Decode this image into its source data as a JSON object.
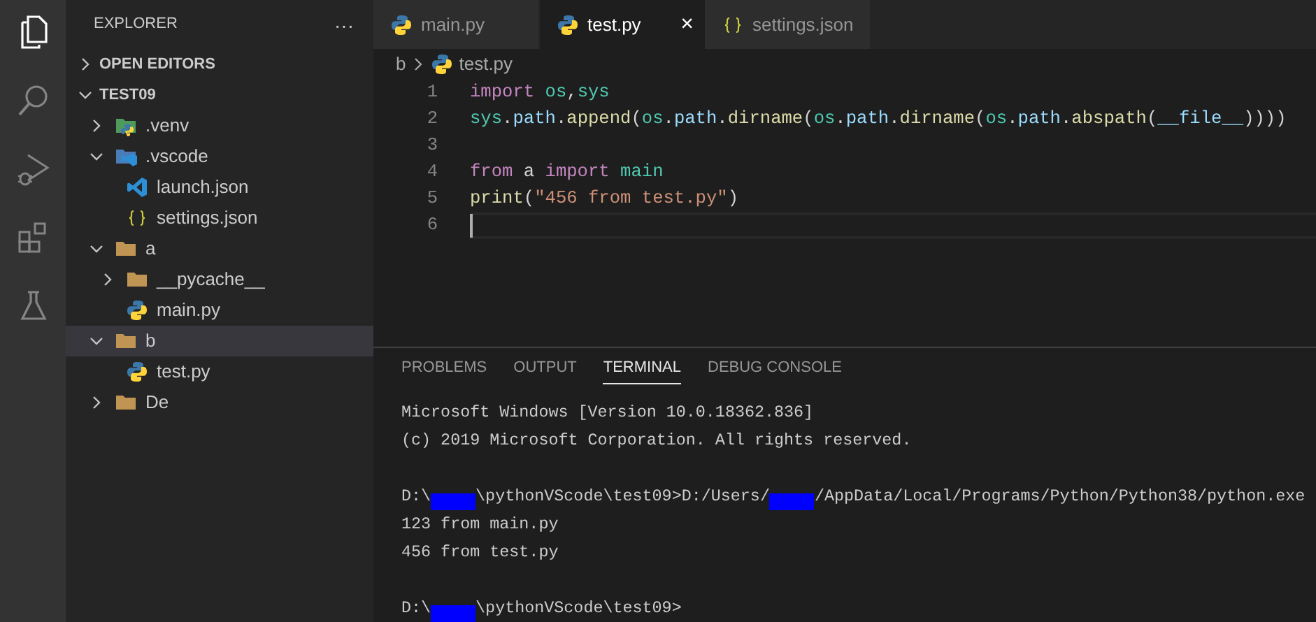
{
  "activity_bar": [
    {
      "kind": "files",
      "selected": true
    },
    {
      "kind": "search",
      "selected": false
    },
    {
      "kind": "debug",
      "selected": false
    },
    {
      "kind": "extensions",
      "selected": false
    },
    {
      "kind": "testing",
      "selected": false
    }
  ],
  "sidebar": {
    "title": "EXPLORER",
    "more": "···",
    "sections": [
      {
        "label": "OPEN EDITORS",
        "expanded": false
      },
      {
        "label": "TEST09",
        "expanded": true
      }
    ],
    "tree": [
      {
        "label": ".venv",
        "kind": "venv-folder",
        "expanded": false,
        "selected": false
      },
      {
        "label": ".vscode",
        "kind": "vscode-folder",
        "expanded": true,
        "selected": false,
        "children": [
          {
            "label": "launch.json",
            "kind": "vscode-file",
            "selected": false
          },
          {
            "label": "settings.json",
            "kind": "json",
            "selected": false
          }
        ]
      },
      {
        "label": "a",
        "kind": "folder",
        "expanded": true,
        "selected": false,
        "children": [
          {
            "label": "__pycache__",
            "kind": "folder",
            "expanded": false,
            "selected": false
          },
          {
            "label": "main.py",
            "kind": "python",
            "selected": false
          }
        ]
      },
      {
        "label": "b",
        "kind": "folder",
        "expanded": true,
        "selected": true,
        "children": [
          {
            "label": "test.py",
            "kind": "python",
            "selected": false
          }
        ]
      },
      {
        "label": "De",
        "kind": "folder",
        "expanded": false,
        "selected": false
      }
    ]
  },
  "tabs": [
    {
      "label": "main.py",
      "kind": "python",
      "selected": false
    },
    {
      "label": "test.py",
      "kind": "python",
      "selected": true,
      "close": "×"
    },
    {
      "label": "settings.json",
      "kind": "json",
      "selected": false
    }
  ],
  "breadcrumb": [
    {
      "label": "b"
    },
    {
      "label": "test.py",
      "kind": "python"
    }
  ],
  "code_lines": [
    {
      "number": "1",
      "current": false,
      "tokens": [
        {
          "text": "import ",
          "kind": "keyword"
        },
        {
          "text": "os",
          "kind": "module"
        },
        {
          "text": ",",
          "kind": "plain"
        },
        {
          "text": "sys",
          "kind": "module"
        }
      ]
    },
    {
      "number": "2",
      "current": false,
      "tokens": [
        {
          "text": "sys",
          "kind": "module"
        },
        {
          "text": ".",
          "kind": "plain"
        },
        {
          "text": "path",
          "kind": "variable"
        },
        {
          "text": ".",
          "kind": "plain"
        },
        {
          "text": "append",
          "kind": "function"
        },
        {
          "text": "(",
          "kind": "plain"
        },
        {
          "text": "os",
          "kind": "module"
        },
        {
          "text": ".",
          "kind": "plain"
        },
        {
          "text": "path",
          "kind": "variable"
        },
        {
          "text": ".",
          "kind": "plain"
        },
        {
          "text": "dirname",
          "kind": "function"
        },
        {
          "text": "(",
          "kind": "plain"
        },
        {
          "text": "os",
          "kind": "module"
        },
        {
          "text": ".",
          "kind": "plain"
        },
        {
          "text": "path",
          "kind": "variable"
        },
        {
          "text": ".",
          "kind": "plain"
        },
        {
          "text": "dirname",
          "kind": "function"
        },
        {
          "text": "(",
          "kind": "plain"
        },
        {
          "text": "os",
          "kind": "module"
        },
        {
          "text": ".",
          "kind": "plain"
        },
        {
          "text": "path",
          "kind": "variable"
        },
        {
          "text": ".",
          "kind": "plain"
        },
        {
          "text": "abspath",
          "kind": "function"
        },
        {
          "text": "(",
          "kind": "plain"
        },
        {
          "text": "__file__",
          "kind": "variable"
        },
        {
          "text": "))))",
          "kind": "plain"
        }
      ]
    },
    {
      "number": "3",
      "current": false
    },
    {
      "number": "4",
      "current": false,
      "tokens": [
        {
          "text": "from ",
          "kind": "keyword"
        },
        {
          "text": "a ",
          "kind": "plain"
        },
        {
          "text": "import ",
          "kind": "keyword"
        },
        {
          "text": "main",
          "kind": "module"
        }
      ]
    },
    {
      "number": "5",
      "current": false,
      "tokens": [
        {
          "text": "print",
          "kind": "function"
        },
        {
          "text": "(",
          "kind": "plain"
        },
        {
          "text": "\"456 from test.py\"",
          "kind": "string"
        },
        {
          "text": ")",
          "kind": "plain"
        }
      ]
    },
    {
      "number": "6",
      "current": true
    }
  ],
  "panel_tabs": [
    {
      "label": "PROBLEMS",
      "selected": false
    },
    {
      "label": "OUTPUT",
      "selected": false
    },
    {
      "label": "TERMINAL",
      "selected": true
    },
    {
      "label": "DEBUG CONSOLE",
      "selected": false
    }
  ],
  "terminal_lines": [
    {
      "segments": [
        {
          "kind": "text",
          "text": "Microsoft Windows [Version 10.0.18362.836]"
        }
      ]
    },
    {
      "segments": [
        {
          "kind": "text",
          "text": "(c) 2019 Microsoft Corporation. All rights reserved."
        }
      ]
    },
    {
      "space_before": true,
      "segments": [
        {
          "kind": "text",
          "text": "D:\\"
        },
        {
          "kind": "redacted"
        },
        {
          "kind": "text",
          "text": "\\pythonVScode\\test09>D:/Users/"
        },
        {
          "kind": "redacted"
        },
        {
          "kind": "text",
          "text": "/AppData/Local/Programs/Python/Python38/python.exe"
        }
      ]
    },
    {
      "segments": [
        {
          "kind": "text",
          "text": "123 from main.py"
        }
      ]
    },
    {
      "segments": [
        {
          "kind": "text",
          "text": "456 from test.py"
        }
      ]
    },
    {
      "space_before": true,
      "segments": [
        {
          "kind": "text",
          "text": "D:\\"
        },
        {
          "kind": "redacted"
        },
        {
          "kind": "text",
          "text": "\\pythonVScode\\test09>"
        }
      ]
    }
  ]
}
